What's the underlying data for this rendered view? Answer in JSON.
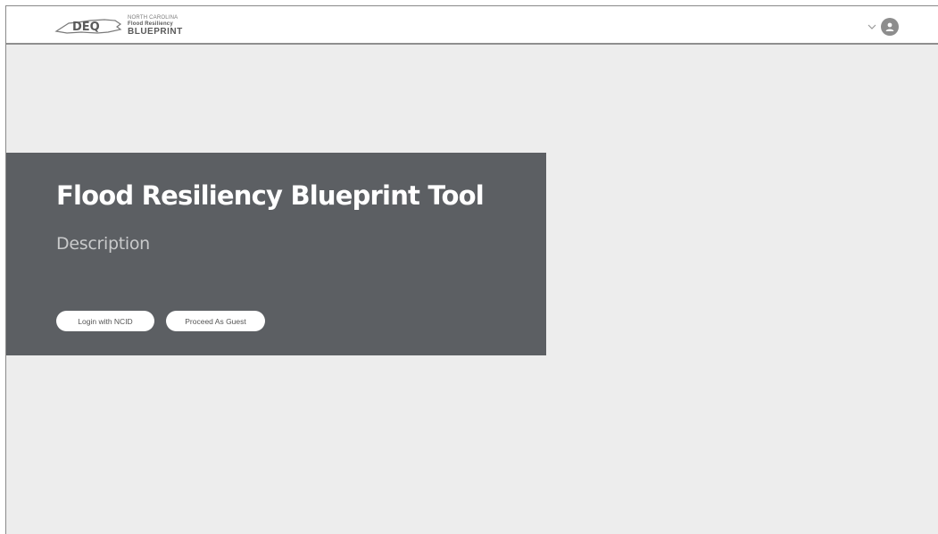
{
  "header": {
    "logo": {
      "mark": "DEQ",
      "line1": "NORTH CAROLINA",
      "line2": "Flood Resiliency",
      "line3": "BLUEPRINT"
    },
    "icons": {
      "menu_toggle": "chevron-down-icon",
      "user": "user-avatar-icon"
    }
  },
  "hero": {
    "title": "Flood Resiliency Blueprint Tool",
    "description": "Description",
    "buttons": {
      "login_label": "Login with NCID",
      "guest_label": "Proceed As Guest"
    }
  },
  "colors": {
    "page_background": "#ededed",
    "header_background": "#ffffff",
    "hero_background": "#5c5f63",
    "button_background": "#ffffff"
  }
}
